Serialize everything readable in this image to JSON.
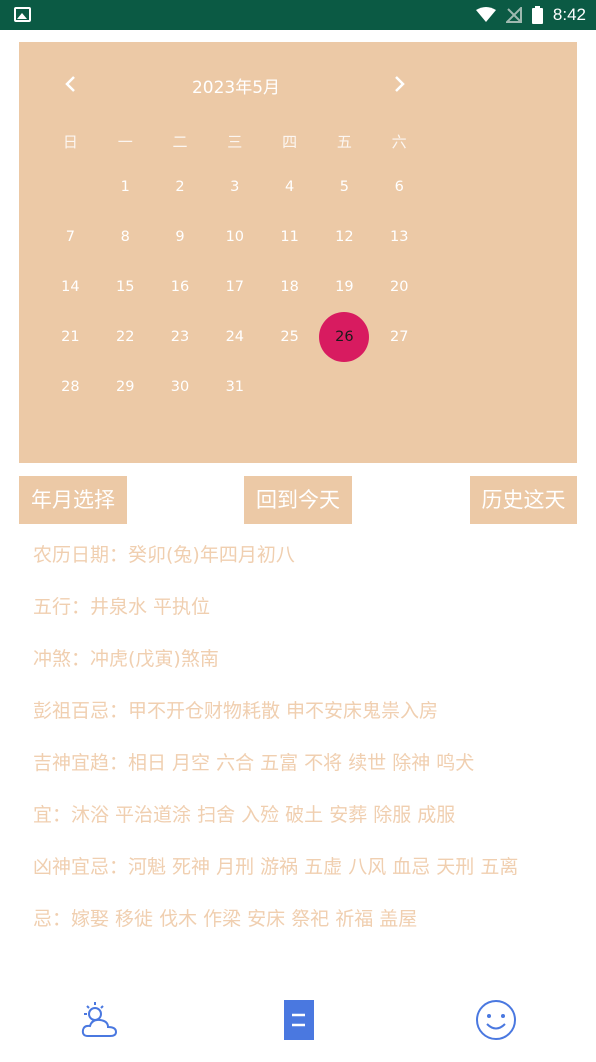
{
  "status_bar": {
    "time": "8:42"
  },
  "calendar": {
    "title": "2023年5月",
    "prev_label": "‹",
    "next_label": "›",
    "weekdays": [
      "日",
      "一",
      "二",
      "三",
      "四",
      "五",
      "六"
    ],
    "days": [
      [
        "",
        "1",
        "2",
        "3",
        "4",
        "5",
        "6"
      ],
      [
        "7",
        "8",
        "9",
        "10",
        "11",
        "12",
        "13"
      ],
      [
        "14",
        "15",
        "16",
        "17",
        "18",
        "19",
        "20"
      ],
      [
        "21",
        "22",
        "23",
        "24",
        "25",
        "26",
        "27"
      ],
      [
        "28",
        "29",
        "30",
        "31",
        "",
        "",
        ""
      ]
    ],
    "selected_day": "26",
    "colors": {
      "background": "#ecc9a6",
      "selected": "#d81b60"
    }
  },
  "actions": {
    "year_month": "年月选择",
    "today": "回到今天",
    "history": "历史这天"
  },
  "info": [
    "农历日期：癸卯(兔)年四月初八",
    "五行：井泉水 平执位",
    "冲煞：冲虎(戊寅)煞南",
    "彭祖百忌：甲不开仓财物耗散 申不安床鬼祟入房",
    "吉神宜趋：相日 月空 六合 五富 不将 续世 除神 鸣犬",
    "宜：沐浴 平治道涂 扫舍 入殓 破土 安葬 除服 成服",
    "凶神宜忌：河魁 死神 月刑 游祸 五虚 八风 血忌 天刑 五离",
    "忌：嫁娶 移徙 伐木 作梁 安床 祭祀 祈福 盖屋"
  ],
  "bottom_nav": {
    "icons": [
      "weather-icon",
      "calendar-doc-icon",
      "smiley-icon"
    ],
    "active_color": "#4a78e0"
  }
}
